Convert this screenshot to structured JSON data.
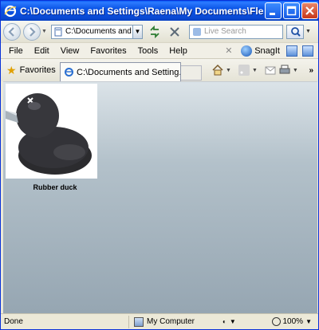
{
  "window": {
    "title": "C:\\Documents and Settings\\Raena\\My Documents\\Flex Builder ..."
  },
  "navbar": {
    "address": "C:\\Documents and Set",
    "search_placeholder": "Live Search"
  },
  "menu": {
    "items": [
      "File",
      "Edit",
      "View",
      "Favorites",
      "Tools",
      "Help"
    ],
    "snagit_label": "SnagIt"
  },
  "favorites": {
    "label": "Favorites",
    "tab_title": "C:\\Documents and Setting..."
  },
  "content": {
    "image_caption": "Rubber duck"
  },
  "status": {
    "text": "Done",
    "zone": "My Computer",
    "zoom": "100%"
  }
}
